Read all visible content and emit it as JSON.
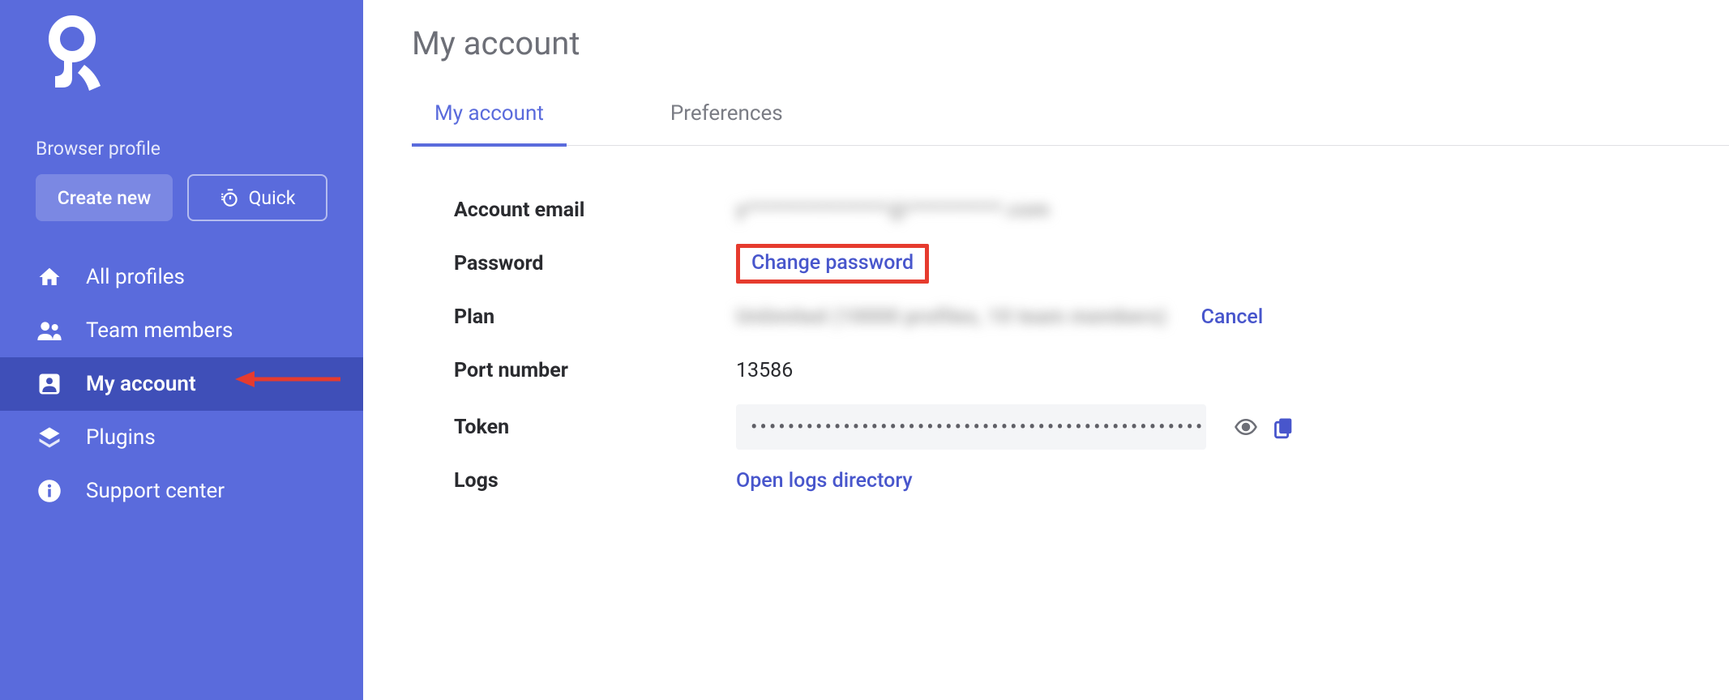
{
  "sidebar": {
    "section_label": "Browser profile",
    "create_button": "Create new",
    "quick_button": "Quick",
    "items": [
      {
        "label": "All profiles"
      },
      {
        "label": "Team members"
      },
      {
        "label": "My account"
      },
      {
        "label": "Plugins"
      },
      {
        "label": "Support center"
      }
    ]
  },
  "page": {
    "title": "My account",
    "tabs": [
      {
        "label": "My account"
      },
      {
        "label": "Preferences"
      }
    ]
  },
  "account": {
    "email_label": "Account email",
    "email_value": "y***************@**********.com",
    "password_label": "Password",
    "change_password": "Change password",
    "plan_label": "Plan",
    "plan_value": "Unlimited (10000 profiles, 10 team members)",
    "plan_cancel": "Cancel",
    "port_label": "Port number",
    "port_value": "13586",
    "token_label": "Token",
    "token_mask": "••••••••••••••••••••••••••••••••••••••••••••••••••••••••••••••••••••••••••••••••••••••••••",
    "logs_label": "Logs",
    "logs_link": "Open logs directory"
  }
}
